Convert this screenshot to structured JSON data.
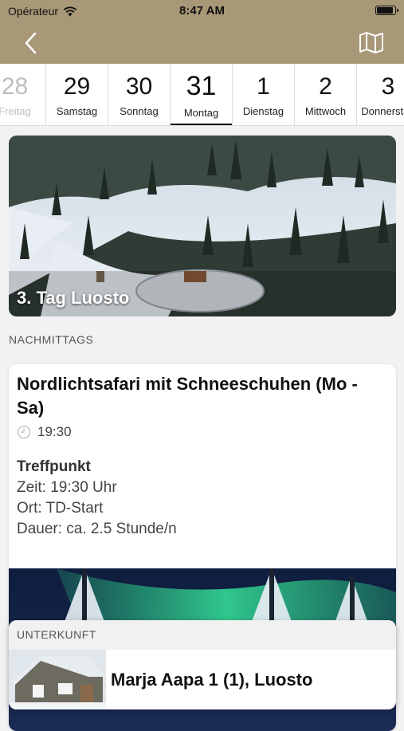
{
  "status": {
    "carrier": "Opérateur",
    "time": "8:47 AM"
  },
  "nav": {
    "back_icon": "chevron-left-icon",
    "map_icon": "map-icon",
    "bar_color": "#a89877"
  },
  "days": [
    {
      "num": "28",
      "name": "Freitag"
    },
    {
      "num": "29",
      "name": "Samstag"
    },
    {
      "num": "30",
      "name": "Sonntag"
    },
    {
      "num": "31",
      "name": "Montag"
    },
    {
      "num": "1",
      "name": "Dienstag"
    },
    {
      "num": "2",
      "name": "Mittwoch"
    },
    {
      "num": "3",
      "name": "Donnerstag"
    }
  ],
  "hero": {
    "title": "3. Tag Luosto"
  },
  "section": {
    "label": "NACHMITTAGS"
  },
  "event": {
    "title": "Nordlichtsafari mit Schneeschuhen (Mo - Sa)",
    "time": "19:30",
    "meeting_heading": "Treffpunkt",
    "meeting_time": "Zeit: 19:30 Uhr",
    "meeting_place": "Ort: TD-Start",
    "meeting_duration": "Dauer: ca. 2.5 Stunde/n"
  },
  "accommodation": {
    "heading": "UNTERKUNFT",
    "name": "Marja Aapa 1 (1), Luosto"
  }
}
